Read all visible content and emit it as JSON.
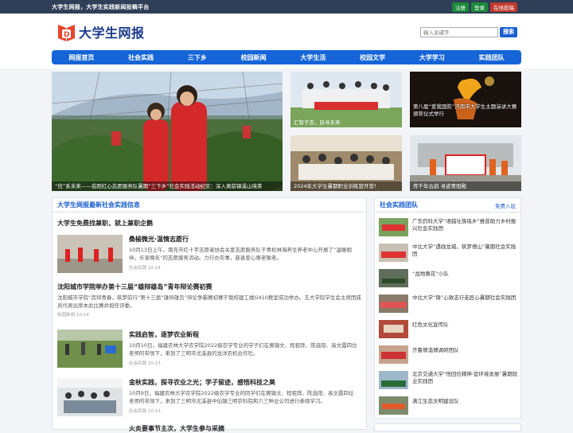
{
  "topbar": {
    "slogan": "大学生网报，大学生实践新闻投稿平台",
    "register": "注册",
    "login": "登录",
    "submit": "在线投稿"
  },
  "header": {
    "site_name": "大学生网报",
    "search_placeholder": "输入关键字",
    "search_button": "搜索"
  },
  "nav": [
    "网报首页",
    "社会实践",
    "三下乡",
    "校园新闻",
    "大学生活",
    "校园文学",
    "大学学习",
    "实践团队"
  ],
  "hero": {
    "main_caption": "“信”系未来——岳阳红心志愿服务队暑期“三下乡”社会实践活动纪实：深入黄前镇溪山境茶",
    "tile1_caption": "汇智于农，跃寻未来",
    "tile2_caption": "第八届“爱我国防”济南市大学生主题演讲大赛颁奖仪式举行",
    "tile3_caption": "2024年大学生暑期职业训练营开营！",
    "tile4_caption": "传千年古韵 寻迹青阳殿"
  },
  "main": {
    "heading": "大学生网报最新社会实践信息",
    "notice": "大学生免费找兼职，就上兼职企鹅",
    "articles": [
      {
        "title": "桑榆微光·温情志愿行",
        "text": "10月13日上午，南充市红十字志愿者协会关爱志愿服务队于青松林海养生养老中心开展了“温暖相伴，乐享晚年”的志愿服务活动。力行办实事，慈善爱心尊老敬老。",
        "meta": "社会实践 10-14"
      },
      {
        "title": "沈阳城市学院举办第十三届“雄辩雄岛”青年辩论赛初赛",
        "text": "沈阳城市学院“百辩青春，筑梦前行”第十三届“雄辩雄岛”辩论争霸赛初赛于我校建工楼G410教室成功举办。五大学院学生会主席团成员代表出席本此比赛并担任评委。",
        "meta": "校园新闻 10-14"
      },
      {
        "title": "实践启智，逐梦农业新程",
        "text": "10月10日，福建农林大学农学院2022级农学专业的学子们在黄镇文、程祖铧、陈选阳、高文霞四位老师的带领下，来到了三明市尤溪县的龙洋农机合作社。",
        "meta": "社会实践 10-13"
      },
      {
        "title": "金秋实践，探寻农业之光；学子留迹，感悟科技之美",
        "text": "10月9日，福建农林大学农学院2022级农学专业的同学们在黄镇文、程祖铧、陈选阳、高文霞四位老师的带领下，来到了三明市尤溪县中仙镇三明农科院和六三种业公司进行参观学习。",
        "meta": "社会实践 10-13"
      },
      {
        "title": "火炎要事节主次，大学生参与采摘",
        "text": "",
        "meta": ""
      }
    ]
  },
  "side": {
    "heading": "社会实践团队",
    "link": "免费入驻",
    "teams": [
      "广东药科大学“语越壮族瑶乡”推普助力乡村振兴社会实践团",
      "中北大学“遇践龙城，筑梦傅山”暑期社会实践团",
      "“战地黄花”小队",
      "中北大学“铸”心致志行走匠心暑期社会实践团",
      "红色文化宣传队",
      "齐鲁情淄博调研团队",
      "北京交通大学“悟回信精神 促环境发展”暑期就业实践团",
      "满江生态文明建设队"
    ]
  },
  "colors": {
    "topbar": "#2f3f57",
    "nav": "#1565d8",
    "accent": "#1a5fd0"
  }
}
